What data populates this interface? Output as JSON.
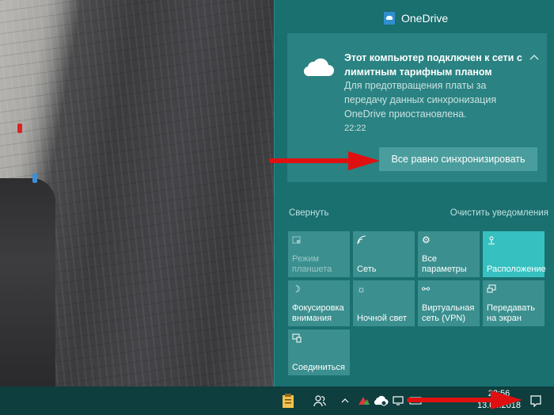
{
  "notification": {
    "app_name": "OneDrive",
    "title": "Этот компьютер подключен к сети с лимитным тарифным планом",
    "body": "Для предотвращения платы за передачу данных синхронизация OneDrive приостановлена.",
    "time": "22:22",
    "action_label": "Все равно синхронизировать",
    "collapse_icon": "chevron-up-icon"
  },
  "links": {
    "collapse": "Свернуть",
    "clear": "Очистить уведомления"
  },
  "quick_actions": [
    {
      "label": "Режим планшета",
      "icon": "tablet-mode-icon",
      "state": "disabled"
    },
    {
      "label": "Сеть",
      "icon": "network-icon",
      "state": "normal"
    },
    {
      "label": "Все параметры",
      "icon": "gear-icon",
      "state": "normal"
    },
    {
      "label": "Расположение",
      "icon": "location-icon",
      "state": "active"
    },
    {
      "label": "Фокусировка внимания",
      "icon": "moon-icon",
      "state": "normal"
    },
    {
      "label": "Ночной свет",
      "icon": "sun-icon",
      "state": "normal"
    },
    {
      "label": "Виртуальная сеть (VPN)",
      "icon": "vpn-icon",
      "state": "normal"
    },
    {
      "label": "Передавать на экран",
      "icon": "project-icon",
      "state": "normal"
    },
    {
      "label": "Соединиться",
      "icon": "connect-icon",
      "state": "normal"
    }
  ],
  "taskbar": {
    "time": "22:56",
    "date": "13.04.2018"
  },
  "colors": {
    "panel_bg": "#1a6f6f",
    "tile_bg": "#3b8f8f",
    "tile_active": "#36c0c0",
    "arrow": "#e01010"
  }
}
